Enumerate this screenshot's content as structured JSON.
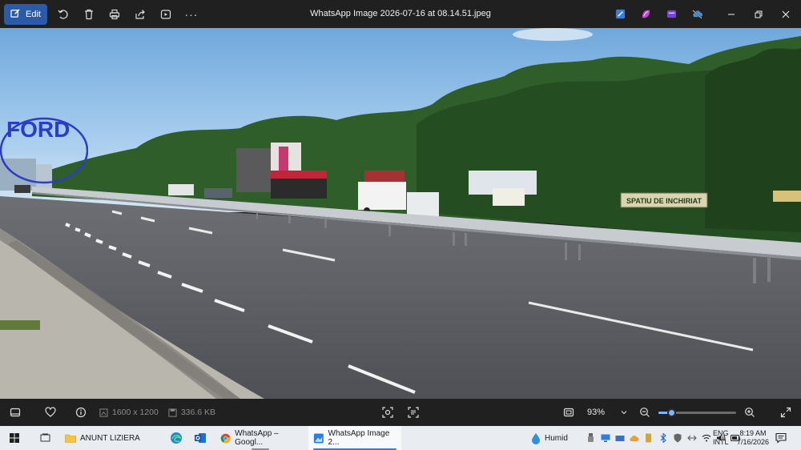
{
  "toolbar": {
    "edit_label": "Edit",
    "buttons": [
      "rotate-icon",
      "delete-icon",
      "print-icon",
      "share-icon",
      "slideshow-icon",
      "more-icon"
    ],
    "more_glyph": "···"
  },
  "window": {
    "title": "WhatsApp Image 2026-07-16 at 08.14.51.jpeg"
  },
  "photo": {
    "overlay_text": "FORD",
    "overlay_color": "#2a3dc4",
    "sign_text": "SPATIU DE INCHIRIAT"
  },
  "infobar": {
    "resolution": "1600 x 1200",
    "file_size": "336.6 KB",
    "zoom_value": "93%",
    "zoom_level": 0.17
  },
  "taskbar": {
    "apps": [
      {
        "label": "ANUNT LIZIERA",
        "icon": "folder-icon"
      },
      {
        "label": "WhatsApp – Googl...",
        "icon": "chrome-icon"
      },
      {
        "label": "WhatsApp Image 2...",
        "icon": "photos-icon"
      }
    ],
    "weather": "Humid",
    "lang_line1": "ENG",
    "lang_line2": "INTL",
    "time": "8:19 AM",
    "date": "7/16/2026"
  },
  "colors": {
    "accent": "#2b5aa8",
    "toolbar_bg": "#202020",
    "taskbar_bg": "#e9edf2"
  }
}
